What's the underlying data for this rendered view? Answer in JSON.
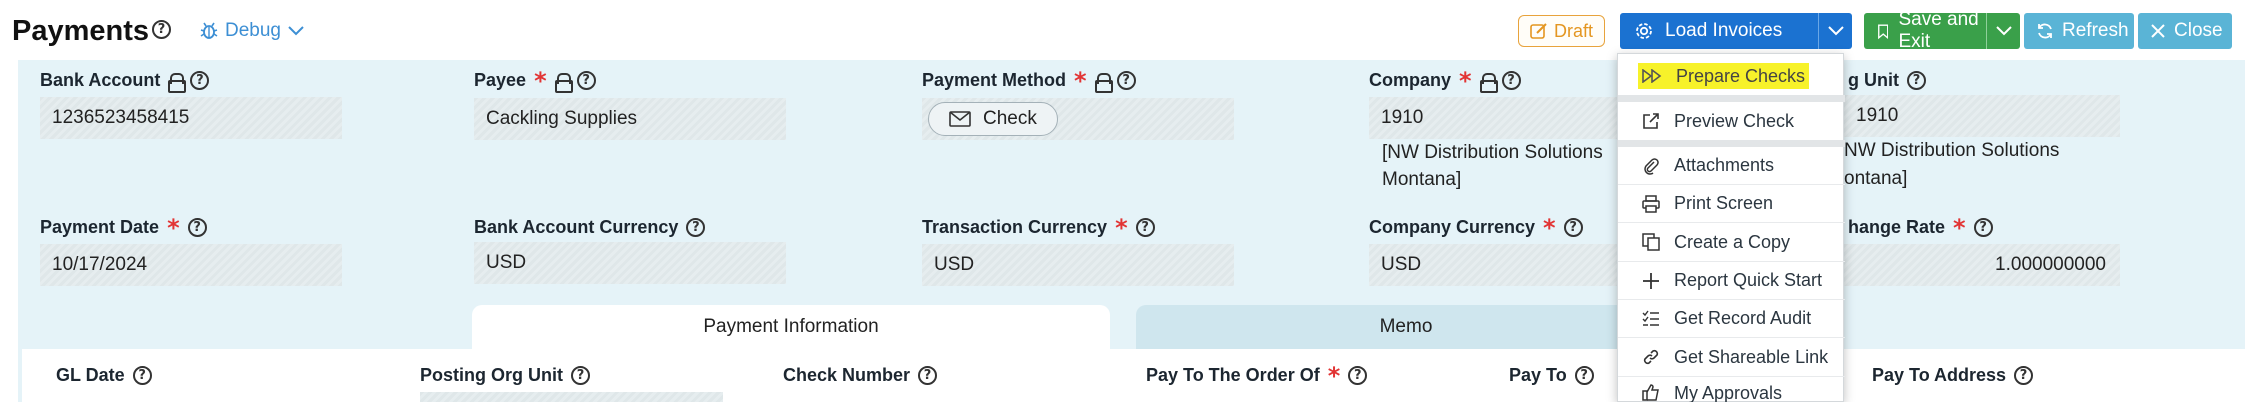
{
  "header": {
    "title": "Payments",
    "debug_label": "Debug",
    "draft_label": "Draft",
    "load_invoices_label": "Load Invoices",
    "save_exit_label": "Save and Exit",
    "refresh_label": "Refresh",
    "close_label": "Close"
  },
  "fields": {
    "bank_account": {
      "label": "Bank Account",
      "value": "1236523458415"
    },
    "payee": {
      "label": "Payee",
      "value": "Cackling Supplies"
    },
    "payment_method": {
      "label": "Payment Method",
      "value": "Check"
    },
    "company": {
      "label": "Company",
      "value": "1910",
      "desc_line1": "[NW Distribution Solutions",
      "desc_line2": "Montana]"
    },
    "org_unit": {
      "label": "g Unit",
      "value": "1910",
      "desc_line1": "NW Distribution Solutions",
      "desc_line2": "ontana]"
    },
    "payment_date": {
      "label": "Payment Date",
      "value": "10/17/2024"
    },
    "bank_account_currency": {
      "label": "Bank Account Currency",
      "value": "USD"
    },
    "transaction_currency": {
      "label": "Transaction Currency",
      "value": "USD"
    },
    "company_currency": {
      "label": "Company Currency",
      "value": "USD"
    },
    "exchange_rate": {
      "label": "hange Rate",
      "value": "1.000000000"
    }
  },
  "tabs": [
    {
      "label": "Payment Information",
      "active": true
    },
    {
      "label": "Memo",
      "active": false
    }
  ],
  "sub_fields": [
    "GL Date",
    "Posting Org Unit",
    "Check Number",
    "Pay To The Order Of",
    "Pay To",
    "Pay To Address"
  ],
  "menu": {
    "items": [
      {
        "label": "Prepare Checks",
        "icon": "fast-forward-icon",
        "highlighted": true
      },
      {
        "label": "Preview Check",
        "icon": "external-link-icon"
      },
      {
        "label": "Attachments",
        "icon": "paperclip-icon"
      },
      {
        "label": "Print Screen",
        "icon": "printer-icon"
      },
      {
        "label": "Create a Copy",
        "icon": "copy-icon"
      },
      {
        "label": "Report Quick Start",
        "icon": "plus-icon"
      },
      {
        "label": "Get Record Audit",
        "icon": "checklist-icon"
      },
      {
        "label": "Get Shareable Link",
        "icon": "link-icon"
      },
      {
        "label": "My Approvals",
        "icon": "thumbs-up-icon"
      }
    ]
  },
  "colors": {
    "primary": "#1b72d1",
    "success": "#3aa04a",
    "info": "#5ab4d6",
    "draft": "#e49621",
    "required": "#e23434",
    "highlight": "#f7f22a",
    "panel": "#e5f3f8"
  }
}
